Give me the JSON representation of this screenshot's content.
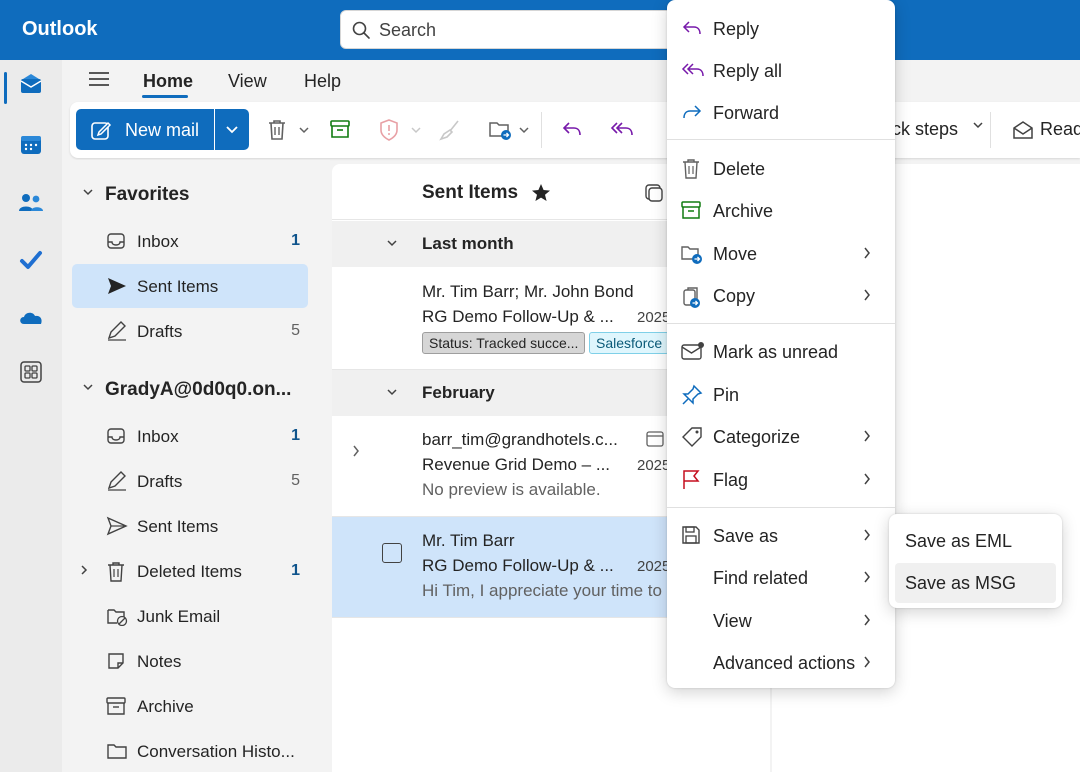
{
  "app": {
    "title": "Outlook"
  },
  "search": {
    "placeholder": "Search"
  },
  "rail": {
    "items": [
      "mail-icon",
      "calendar-icon",
      "people-icon",
      "todo-icon",
      "onedrive-icon",
      "apps-icon"
    ]
  },
  "ribbon": {
    "tabs": [
      "Home",
      "View",
      "Help"
    ],
    "active_tab": "Home"
  },
  "toolbar": {
    "new_mail": "New mail",
    "quick_steps": "ick steps",
    "read": "Read"
  },
  "folders": {
    "favorites": {
      "label": "Favorites",
      "items": [
        {
          "label": "Inbox",
          "count": "1",
          "icon": "inbox-icon"
        },
        {
          "label": "Sent Items",
          "count": "",
          "icon": "send-icon"
        },
        {
          "label": "Drafts",
          "count": "5",
          "icon": "drafts-icon"
        }
      ]
    },
    "account": {
      "label": "GradyA@0d0q0.on...",
      "items": [
        {
          "label": "Inbox",
          "count": "1",
          "icon": "inbox-icon"
        },
        {
          "label": "Drafts",
          "count": "5",
          "icon": "drafts-icon"
        },
        {
          "label": "Sent Items",
          "count": "",
          "icon": "send-icon"
        },
        {
          "label": "Deleted Items",
          "count": "1",
          "icon": "trash-icon"
        },
        {
          "label": "Junk Email",
          "count": "",
          "icon": "junk-icon"
        },
        {
          "label": "Notes",
          "count": "",
          "icon": "notes-icon"
        },
        {
          "label": "Archive",
          "count": "",
          "icon": "archive-icon"
        },
        {
          "label": "Conversation Histo...",
          "count": "",
          "icon": "folder-icon"
        }
      ]
    }
  },
  "message_list": {
    "title": "Sent Items",
    "groups": [
      {
        "label": "Last month"
      },
      {
        "label": "February"
      }
    ],
    "messages": [
      {
        "from": "Mr. Tim Barr; Mr. John Bond",
        "subject": "RG Demo Follow-Up & ...",
        "date": "2025",
        "tags": [
          "Status: Tracked succe...",
          "Salesforce"
        ]
      },
      {
        "from": "barr_tim@grandhotels.c...",
        "subject": "Revenue Grid Demo – ...",
        "date": "2025",
        "preview": "No preview is available."
      },
      {
        "from": "Mr. Tim Barr",
        "subject": "RG Demo Follow-Up & ...",
        "date": "2025",
        "preview": "Hi Tim, I appreciate your time to"
      }
    ]
  },
  "context_menu": {
    "items": [
      {
        "label": "Reply",
        "icon": "reply-icon"
      },
      {
        "label": "Reply all",
        "icon": "reply-all-icon"
      },
      {
        "label": "Forward",
        "icon": "forward-icon"
      },
      {
        "label": "Delete",
        "icon": "trash-icon"
      },
      {
        "label": "Archive",
        "icon": "archive-icon"
      },
      {
        "label": "Move",
        "icon": "move-folder-icon"
      },
      {
        "label": "Copy",
        "icon": "copy-icon"
      },
      {
        "label": "Mark as unread",
        "icon": "mark-unread-icon"
      },
      {
        "label": "Pin",
        "icon": "pin-icon"
      },
      {
        "label": "Categorize",
        "icon": "tag-icon"
      },
      {
        "label": "Flag",
        "icon": "flag-icon"
      },
      {
        "label": "Save as",
        "icon": "save-icon"
      },
      {
        "label": "Find related",
        "icon": ""
      },
      {
        "label": "View",
        "icon": ""
      },
      {
        "label": "Advanced actions",
        "icon": ""
      }
    ]
  },
  "save_as_submenu": {
    "items": [
      {
        "label": "Save as EML"
      },
      {
        "label": "Save as MSG"
      }
    ],
    "hovered": "Save as MSG"
  },
  "colors": {
    "brand": "#0f6cbd",
    "selected": "#cfe4fa",
    "reply_purple": "#7719aa",
    "archive_green": "#107c10",
    "flag_red": "#c50f1f"
  }
}
